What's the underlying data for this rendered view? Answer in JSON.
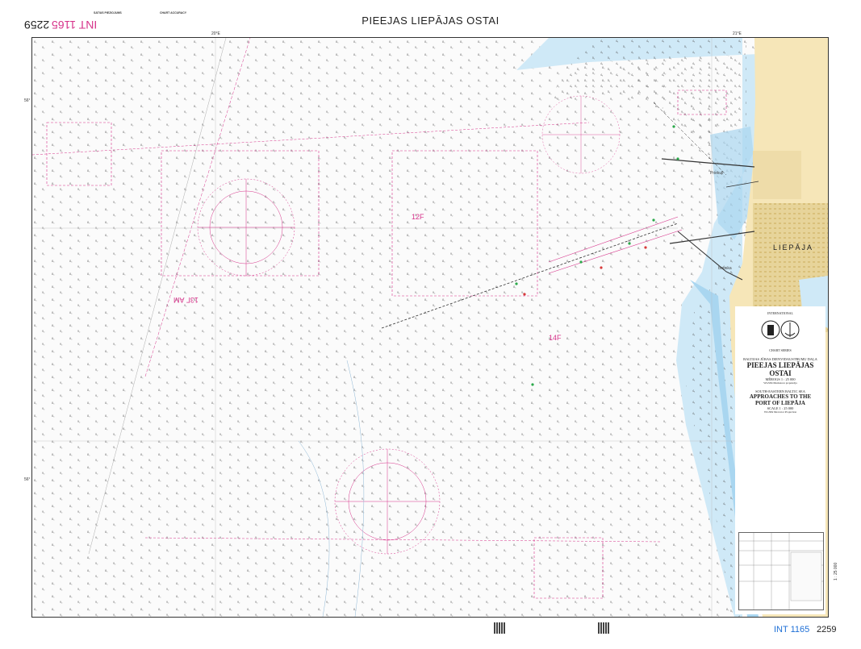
{
  "header": {
    "title": "PIEEJAS LIEPĀJAS OSTAI",
    "int_label": "INT 1165",
    "chart_number": "2259"
  },
  "notes": {
    "left_heading": "SATIUS PIEZIOJUMS",
    "right_heading": "CHART ACCURACY"
  },
  "map": {
    "town_label": "LIEPĀJA",
    "places": [
      "Priekuļi",
      "Bauska"
    ],
    "areas": [
      "12F",
      "13Г AM",
      "14F"
    ],
    "compass_rose_count": 2,
    "latitude_marks": [
      "56°",
      "56°"
    ],
    "longitude_marks": [
      "20°E",
      "21°E"
    ],
    "colors": {
      "deep_water": "#fbfbfb",
      "shallow_water": "#cfe9f7",
      "very_shallow": "#a9d6f0",
      "land": "#f6e6b8",
      "town": "#e7d49a",
      "magenta": "#d6338a"
    }
  },
  "panel": {
    "org": "INTERNATIONAL",
    "org_bottom": "CHART SERIES",
    "title_lv_sub": "BALTIJAS JŪRAS DIENVIDAUSTRUMU DAĻA",
    "title_lv": "PIEEJAS LIEPĀJAS OSTAI",
    "scale_lv": "MĒROGS 1 : 25 000",
    "proj_lv": "WGS84 Merkatora projekcija",
    "title_en_sub": "SOUTH-EASTERN BALTIC SEA",
    "title_en_1": "APPROACHES TO THE",
    "title_en_2": "PORT OF LIEPĀJA",
    "scale_en": "SCALE 1 : 25 000",
    "proj_en": "WGS84 Mercator Projection"
  },
  "footer": {
    "int_label": "INT 1165",
    "chart_number": "2259",
    "scale_side": "1 : 25 000"
  }
}
